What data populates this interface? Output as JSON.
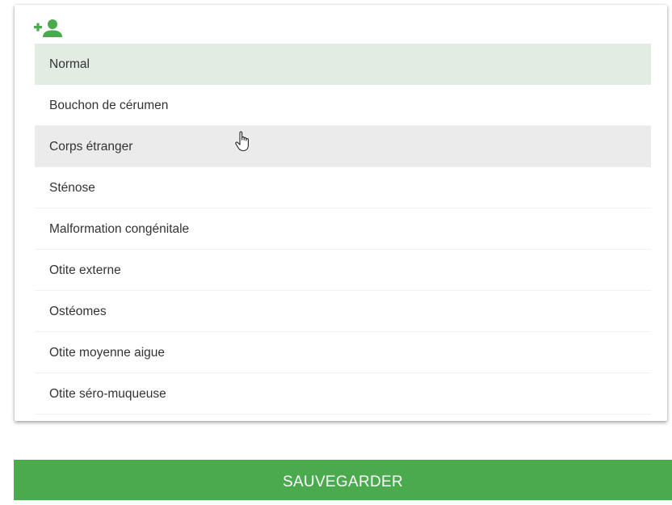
{
  "header": {
    "add_user_icon": "person-add-icon",
    "accent_color": "#4aab4e"
  },
  "options": [
    {
      "label": "Normal",
      "state": "selected"
    },
    {
      "label": "Bouchon de cérumen",
      "state": ""
    },
    {
      "label": "Corps étranger",
      "state": "hovered"
    },
    {
      "label": "Sténose",
      "state": ""
    },
    {
      "label": "Malformation congénitale",
      "state": ""
    },
    {
      "label": "Otite externe",
      "state": ""
    },
    {
      "label": "Ostéomes",
      "state": ""
    },
    {
      "label": "Otite moyenne aigue",
      "state": ""
    },
    {
      "label": "Otite séro-muqueuse",
      "state": ""
    }
  ],
  "cursor_icon": "hand-pointer-icon",
  "footer": {
    "save_label": "SAUVEGARDER"
  }
}
